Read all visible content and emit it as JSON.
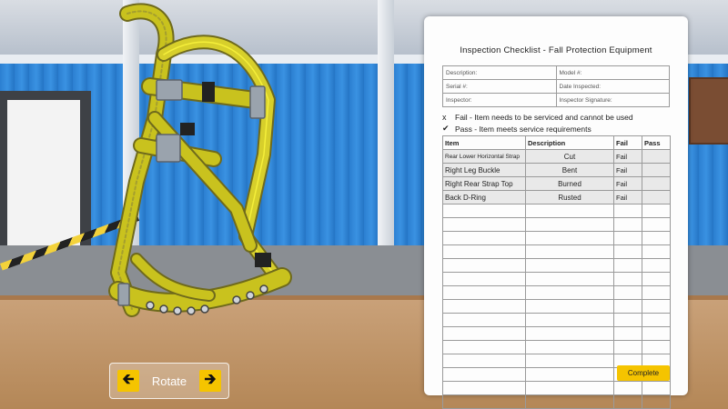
{
  "rotate": {
    "label": "Rotate",
    "left_icon": "arrow-left-icon",
    "right_icon": "arrow-right-icon"
  },
  "checklist": {
    "title": "Inspection Checklist - Fall Protection Equipment",
    "fields": {
      "description": "Description:",
      "model": "Model #:",
      "serial": "Serial #:",
      "date_inspected": "Date Inspected:",
      "inspector": "Inspector:",
      "inspector_signature": "Inspector Signature:"
    },
    "legend": {
      "fail_symbol": "x",
      "fail_text": "Fail - Item needs to be serviced and cannot be used",
      "pass_symbol": "✔",
      "pass_text": "Pass - Item meets service requirements"
    },
    "columns": {
      "item": "Item",
      "description": "Description",
      "fail": "Fail",
      "pass": "Pass"
    },
    "rows": [
      {
        "item": "Rear Lower Horizontal Strap",
        "description": "Cut",
        "fail": "Fail",
        "pass": ""
      },
      {
        "item": "Right Leg Buckle",
        "description": "Bent",
        "fail": "Fail",
        "pass": ""
      },
      {
        "item": "Right Rear Strap Top",
        "description": "Burned",
        "fail": "Fail",
        "pass": ""
      },
      {
        "item": "Back D-Ring",
        "description": "Rusted",
        "fail": "Fail",
        "pass": ""
      }
    ],
    "complete_label": "Complete"
  },
  "colors": {
    "accent": "#f5c400",
    "wall": "#2b7fd1"
  }
}
